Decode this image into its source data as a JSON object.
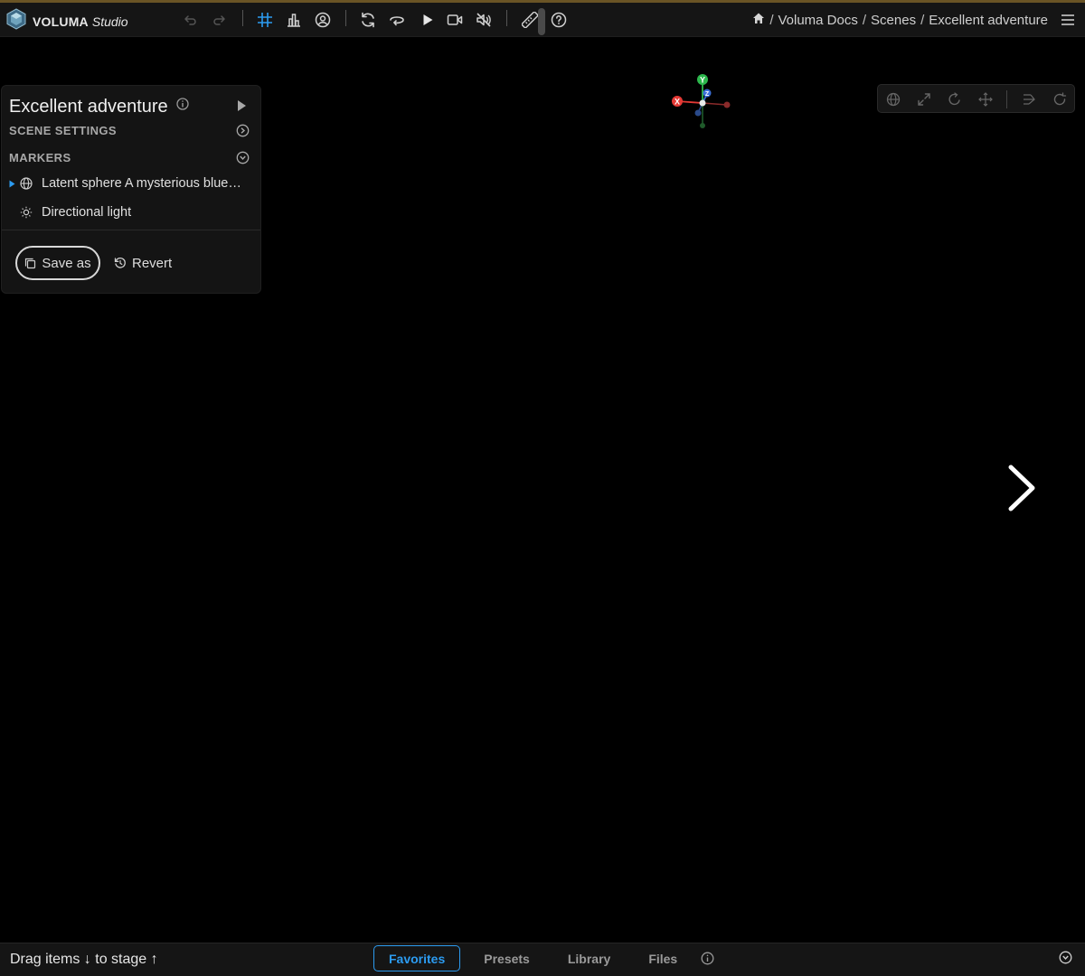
{
  "app": {
    "brand": "VOLUMA",
    "brand_suffix": "Studio"
  },
  "toolbar": {
    "icons": [
      "undo-icon",
      "redo-icon",
      "grid-icon",
      "chart-icon",
      "user-circle-icon",
      "refresh-icon",
      "rotate-icon",
      "play-icon",
      "video-icon",
      "mute-icon",
      "ruler-icon",
      "help-icon"
    ]
  },
  "breadcrumb": {
    "items": [
      "Voluma Docs",
      "Scenes",
      "Excellent adventure"
    ],
    "separator": "/"
  },
  "panel": {
    "title": "Excellent adventure",
    "sections": {
      "scene_settings": "SCENE SETTINGS",
      "markers": "MARKERS"
    },
    "markers": [
      {
        "label": "Latent sphere A mysterious blue…",
        "icon": "globe-icon"
      },
      {
        "label": "Directional light",
        "icon": "sun-icon"
      }
    ],
    "save_as_label": "Save as",
    "revert_label": "Revert"
  },
  "gizmo": {
    "x_label": "X",
    "y_label": "Y",
    "z_label": "Z"
  },
  "bottom": {
    "drag_hint": "Drag items ↓ to stage ↑",
    "tabs": [
      {
        "label": "Favorites",
        "active": true
      },
      {
        "label": "Presets",
        "active": false
      },
      {
        "label": "Library",
        "active": false
      },
      {
        "label": "Files",
        "active": false
      }
    ]
  },
  "colors": {
    "accent": "#2c9bf0",
    "axis_x": "#e53935",
    "axis_y": "#2db84d",
    "axis_z": "#3a6fd8",
    "top_line": "#6a5425"
  }
}
